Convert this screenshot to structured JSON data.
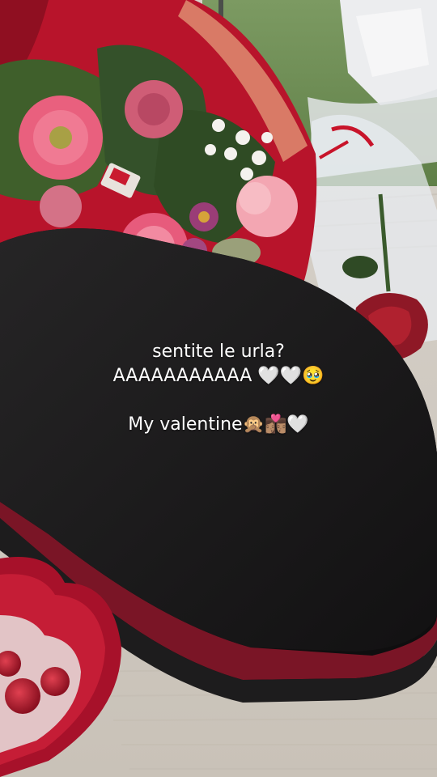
{
  "story": {
    "caption_line1": "sentite le urla?",
    "caption_line2": "AAAAAAAAAAA 🤍🤍🥹",
    "caption_line3": "My valentine🙊👩🏽‍❤️‍💋‍👨🏽🤍"
  },
  "objects": [
    "flower-bouquet",
    "gift-box-black-oval",
    "single-red-rose",
    "heart-chocolate-box"
  ],
  "colors": {
    "box": "#1b1a1b",
    "wrapping": "#b3142a",
    "bedsheet": "#d7d1c8",
    "grass": "#6f8f55",
    "pink_flowers": "#e6557f"
  }
}
